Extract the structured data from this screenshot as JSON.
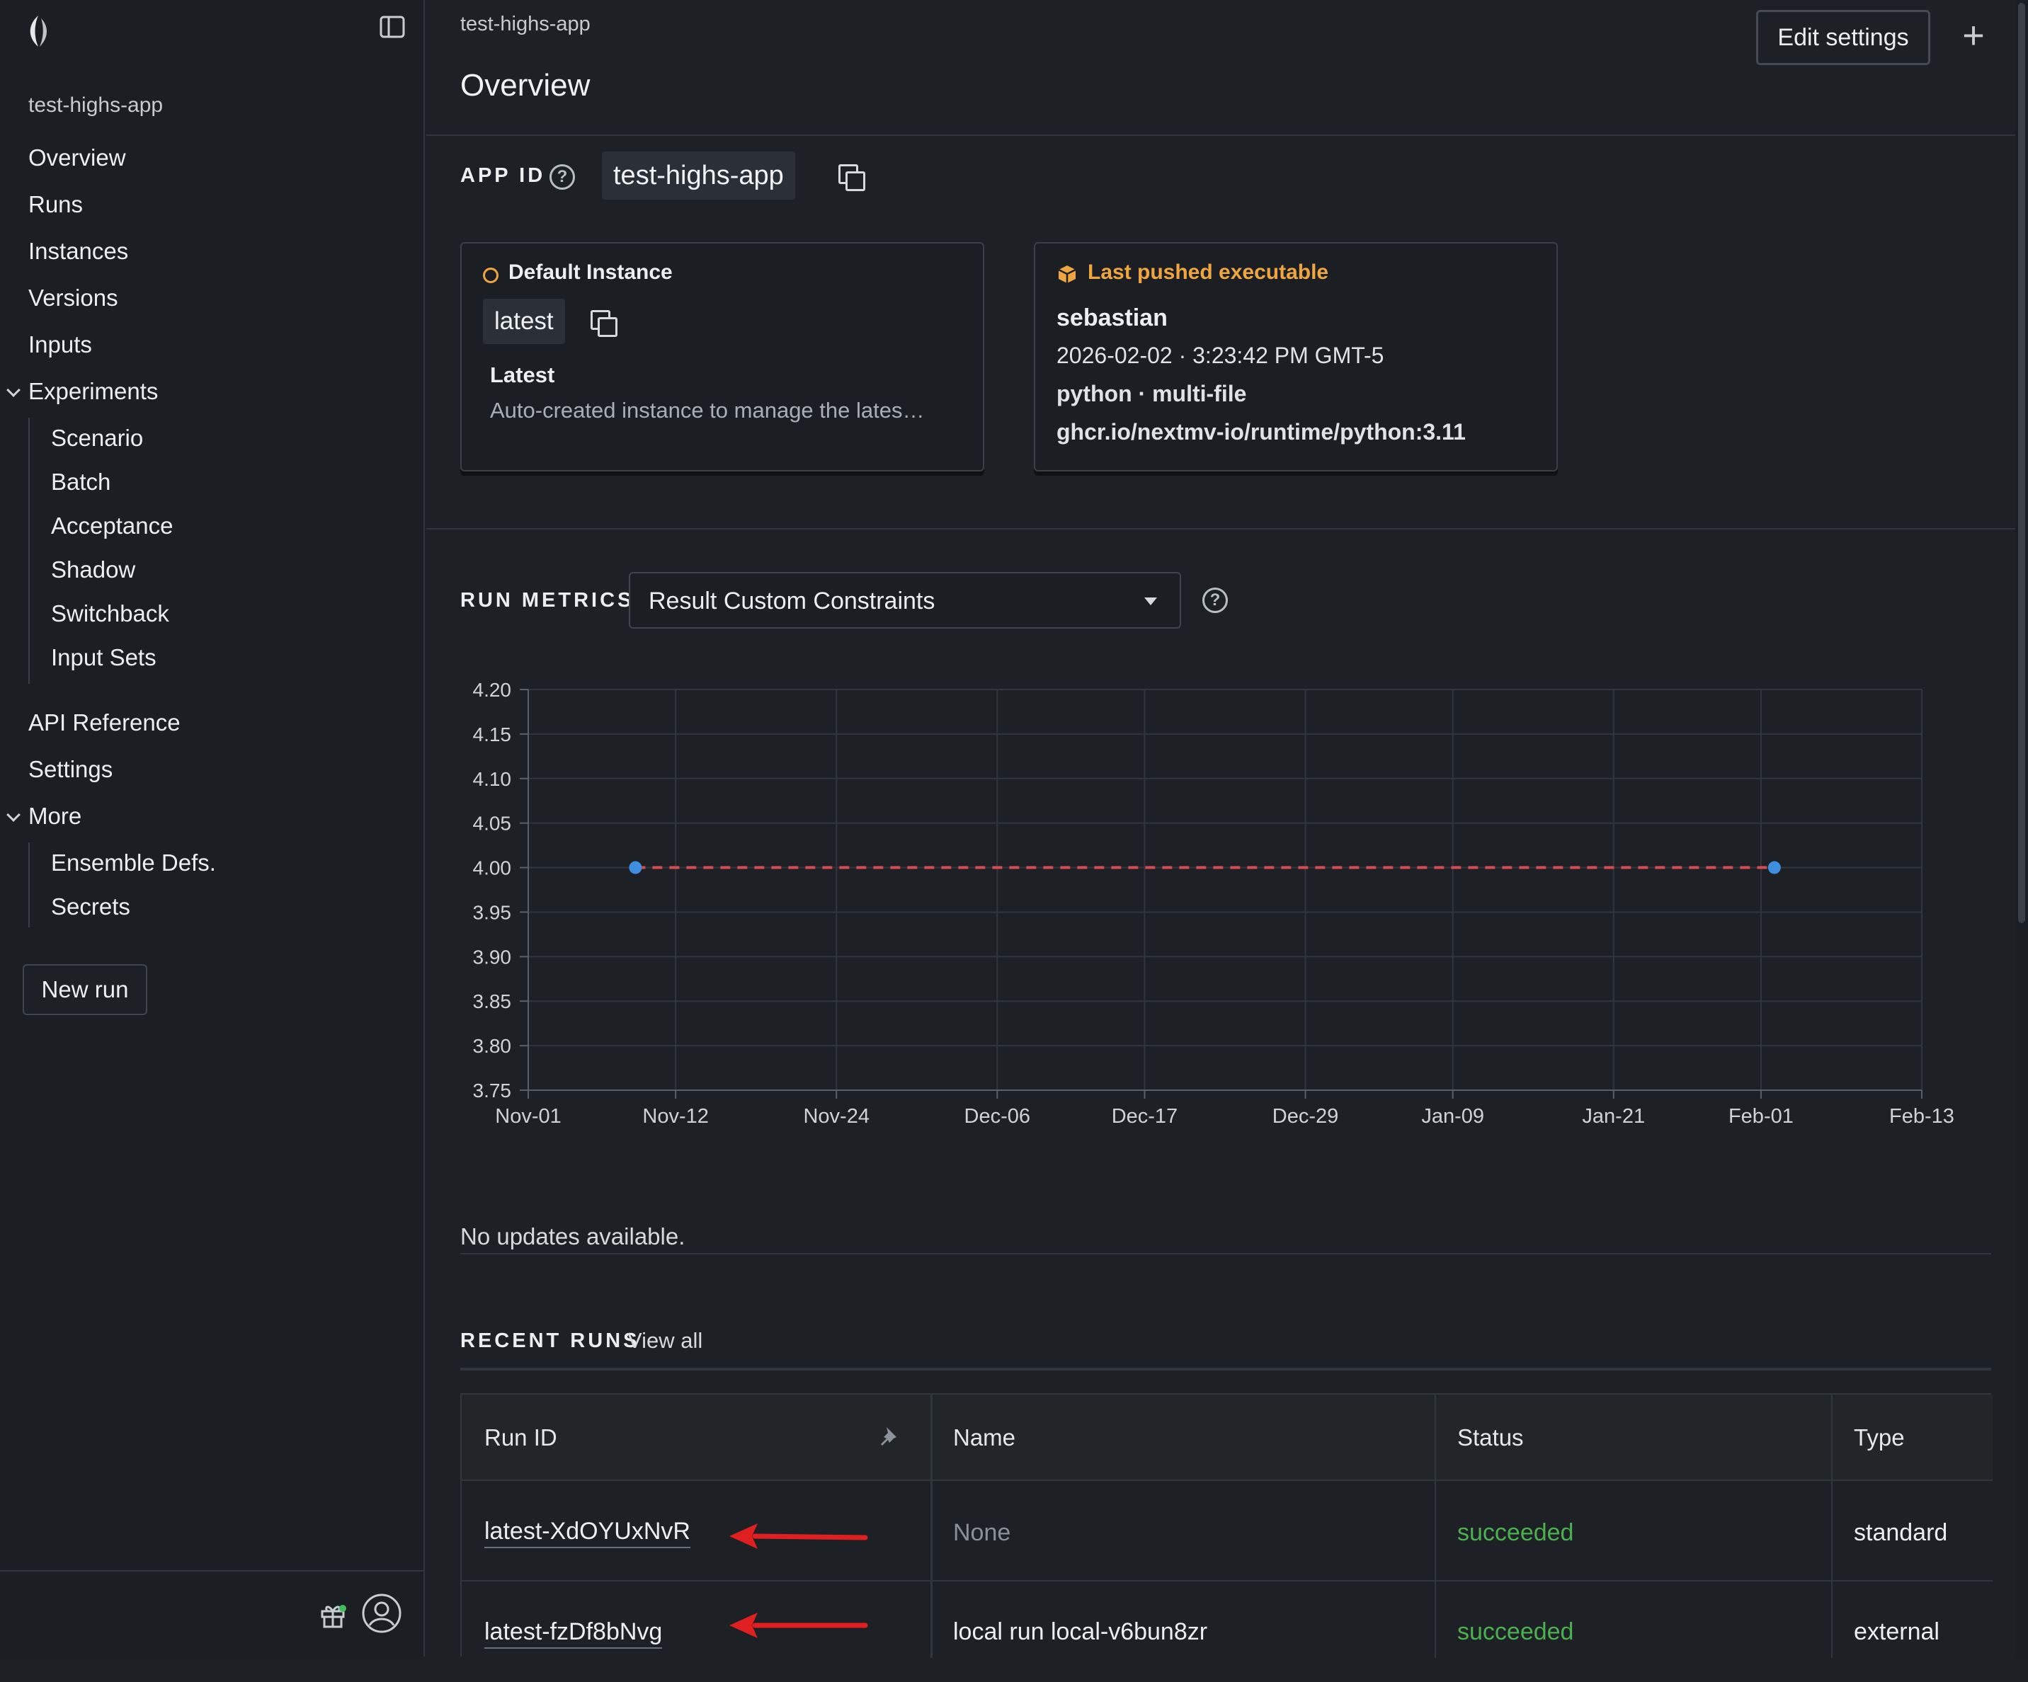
{
  "sidebar": {
    "app_name": "test-highs-app",
    "nav": {
      "overview": "Overview",
      "runs": "Runs",
      "instances": "Instances",
      "versions": "Versions",
      "inputs": "Inputs",
      "experiments": "Experiments",
      "scenario": "Scenario",
      "batch": "Batch",
      "acceptance": "Acceptance",
      "shadow": "Shadow",
      "switchback": "Switchback",
      "input_sets": "Input Sets",
      "api_reference": "API Reference",
      "settings": "Settings",
      "more": "More",
      "ensemble_defs": "Ensemble Defs.",
      "secrets": "Secrets"
    },
    "new_run": "New run"
  },
  "header": {
    "breadcrumb": "test-highs-app",
    "title": "Overview",
    "edit_settings": "Edit settings",
    "plus": "+"
  },
  "app_id": {
    "label": "APP ID",
    "value": "test-highs-app"
  },
  "default_instance": {
    "title": "Default Instance",
    "id": "latest",
    "name": "Latest",
    "description": "Auto-created instance to manage the lates…"
  },
  "last_pushed": {
    "title": "Last pushed executable",
    "user": "sebastian",
    "timestamp": "2026-02-02 · 3:23:42 PM GMT-5",
    "runtime": "python · multi-file",
    "image": "ghcr.io/nextmv-io/runtime/python:3.11"
  },
  "run_metrics": {
    "label": "RUN METRICS",
    "selected": "Result Custom Constraints"
  },
  "chart_data": {
    "type": "line",
    "x_ticks": [
      "Nov-01",
      "Nov-12",
      "Nov-24",
      "Dec-06",
      "Dec-17",
      "Dec-29",
      "Jan-09",
      "Jan-21",
      "Feb-01",
      "Feb-13"
    ],
    "y_ticks": [
      "4.20",
      "4.15",
      "4.10",
      "4.05",
      "4.00",
      "3.95",
      "3.90",
      "3.85",
      "3.80",
      "3.75"
    ],
    "ylim": [
      3.75,
      4.2
    ],
    "xlim": [
      "Nov-01",
      "Feb-13"
    ],
    "points": [
      {
        "x": "Nov-09",
        "y": 4.0
      },
      {
        "x": "Feb-02",
        "y": 4.0
      }
    ],
    "line_color": "#d94a55",
    "point_color": "#3f8fe0",
    "grid": true
  },
  "updates_text": "No updates available.",
  "recent_runs": {
    "label": "RECENT RUNS",
    "view_all": "View all",
    "columns": [
      "Run ID",
      "Name",
      "Status",
      "Type"
    ],
    "rows": [
      {
        "run_id": "latest-XdOYUxNvR",
        "name": "None",
        "status": "succeeded",
        "type": "standard"
      },
      {
        "run_id": "latest-fzDf8bNvg",
        "name": "local run local-v6bun8zr",
        "status": "succeeded",
        "type": "external"
      }
    ]
  },
  "colors": {
    "accent_orange": "#f0a640",
    "success_green": "#4caf50",
    "annotation_red": "#e02020"
  }
}
